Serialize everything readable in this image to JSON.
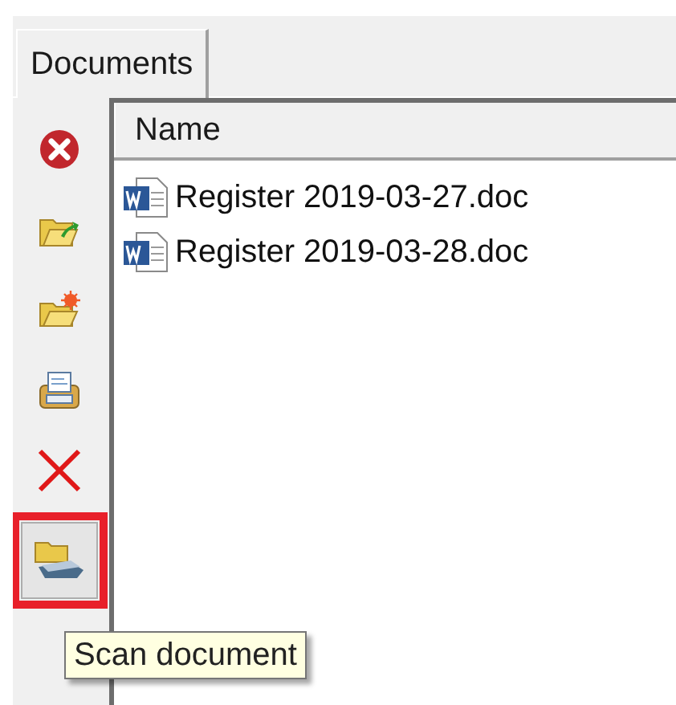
{
  "tabs": [
    {
      "label": "Documents",
      "selected": true
    }
  ],
  "toolbar": [
    {
      "kind": "cancel",
      "highlighted": false
    },
    {
      "kind": "open-folder",
      "highlighted": false
    },
    {
      "kind": "new-folder",
      "highlighted": false
    },
    {
      "kind": "print",
      "highlighted": false
    },
    {
      "kind": "delete",
      "highlighted": false
    },
    {
      "kind": "scan",
      "highlighted": true
    }
  ],
  "file_list": {
    "columns": [
      "Name"
    ],
    "rows": [
      {
        "name": "Register 2019-03-27.doc"
      },
      {
        "name": "Register 2019-03-28.doc"
      }
    ]
  },
  "tooltip": {
    "text": "Scan document"
  }
}
